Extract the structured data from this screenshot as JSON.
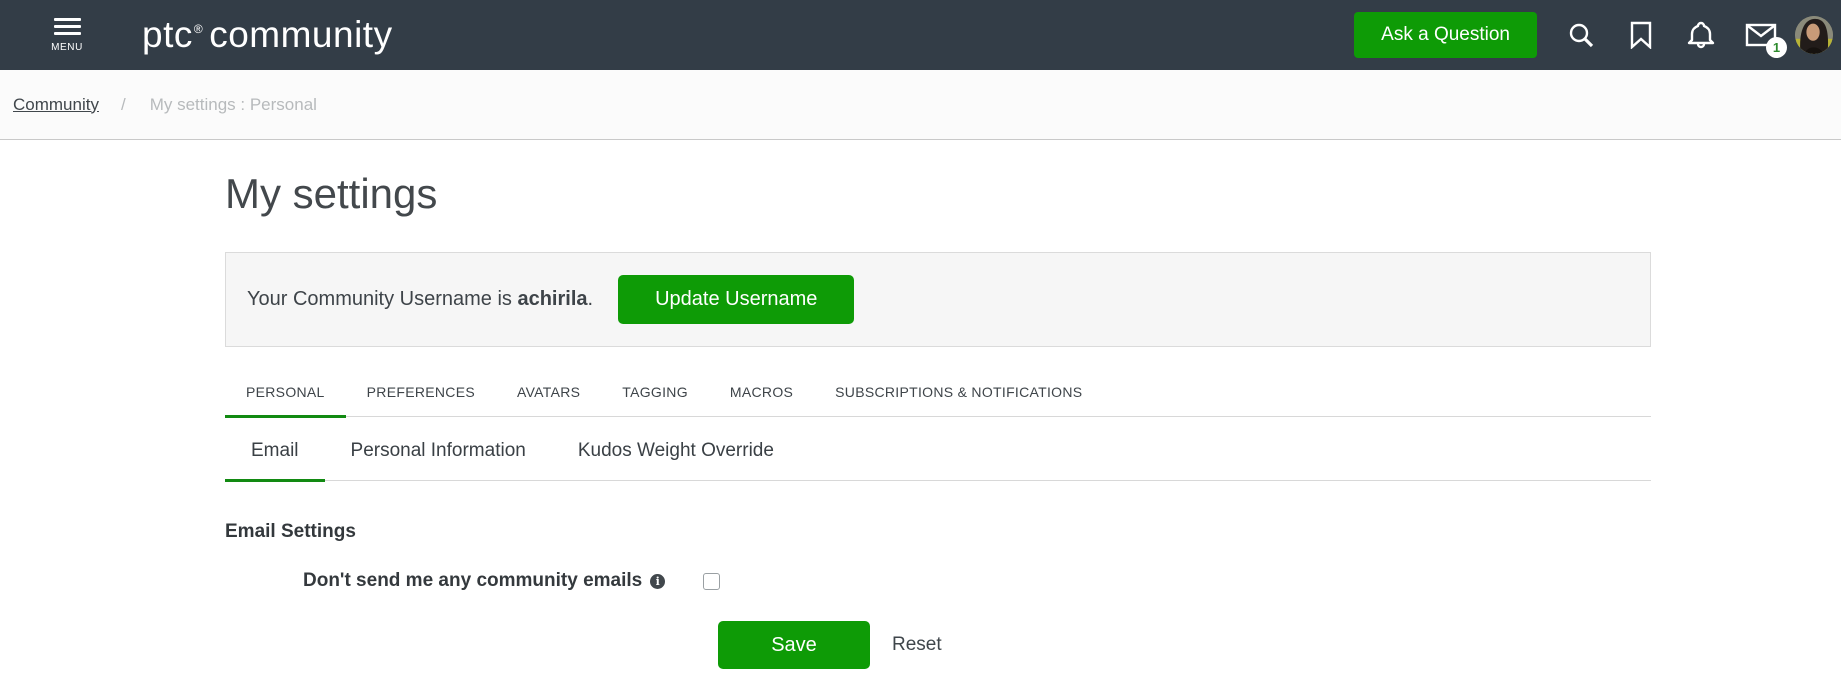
{
  "navbar": {
    "menu_label": "MENU",
    "logo_ptc": "ptc",
    "logo_reg": "®",
    "logo_community": "community",
    "ask_button": "Ask a Question",
    "message_badge": "1"
  },
  "breadcrumb": {
    "root": "Community",
    "separator": "/",
    "current": "My settings : Personal"
  },
  "page": {
    "title": "My settings"
  },
  "username_box": {
    "text_prefix": "Your Community Username is ",
    "username": "achirila",
    "text_suffix": ".",
    "button": "Update Username"
  },
  "tabs": {
    "items": [
      {
        "label": "PERSONAL",
        "active": true
      },
      {
        "label": "PREFERENCES",
        "active": false
      },
      {
        "label": "AVATARS",
        "active": false
      },
      {
        "label": "TAGGING",
        "active": false
      },
      {
        "label": "MACROS",
        "active": false
      },
      {
        "label": "SUBSCRIPTIONS & NOTIFICATIONS",
        "active": false
      }
    ]
  },
  "subtabs": {
    "items": [
      {
        "label": "Email",
        "active": true
      },
      {
        "label": "Personal Information",
        "active": false
      },
      {
        "label": "Kudos Weight Override",
        "active": false
      }
    ]
  },
  "email_settings": {
    "heading": "Email Settings",
    "checkbox_label": "Don't send me any community emails",
    "info_icon_glyph": "i",
    "checkbox_checked": false
  },
  "actions": {
    "save": "Save",
    "reset": "Reset"
  },
  "colors": {
    "navbar_bg": "#333d47",
    "button_green": "#0e9b06",
    "active_tab_underline": "#128a12",
    "badge_text_green": "#2e8b2e"
  }
}
